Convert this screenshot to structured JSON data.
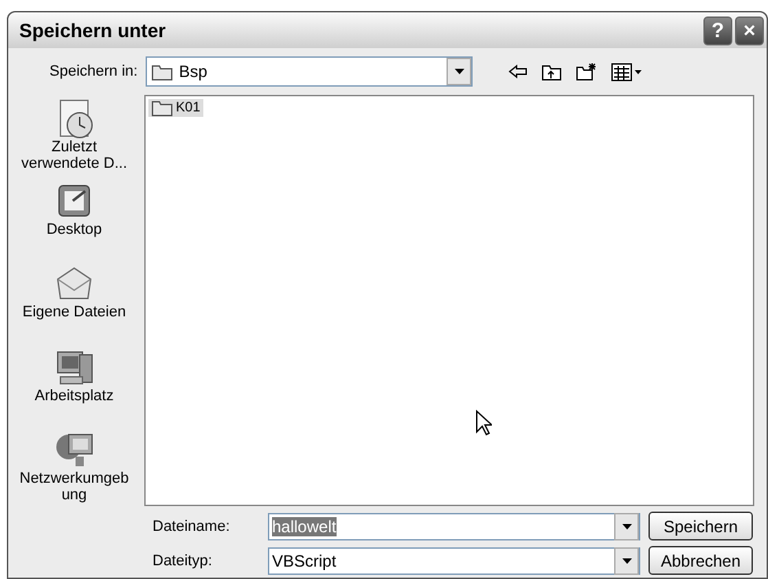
{
  "window": {
    "title": "Speichern unter",
    "buttons": [
      "?",
      "×"
    ]
  },
  "location": {
    "label": "Speichern in:",
    "value": "Bsp"
  },
  "places": [
    {
      "label": "Zuletzt verwendete D...",
      "kind": "recent"
    },
    {
      "label": "Desktop",
      "kind": "desktop"
    },
    {
      "label": "Eigene Dateien",
      "kind": "documents"
    },
    {
      "label": "Arbeitsplatz",
      "kind": "computer"
    },
    {
      "label": "Netzwerkumgeb ung",
      "kind": "network"
    }
  ],
  "files": [
    {
      "name": "K01",
      "selected": true
    }
  ],
  "filename": {
    "label": "Dateiname:",
    "value": "hallowelt",
    "text_selected": true
  },
  "filetype": {
    "label": "Dateityp:",
    "value": "VBScript"
  },
  "buttons": [
    "Speichern",
    "Abbrechen"
  ]
}
